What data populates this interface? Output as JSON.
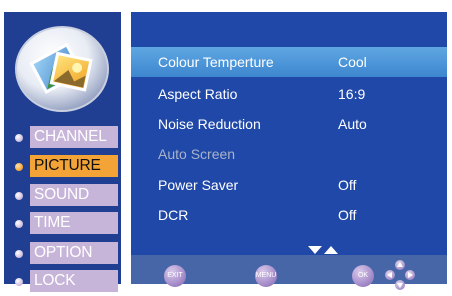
{
  "sidebar": {
    "items": [
      {
        "label": "CHANNEL",
        "active": false
      },
      {
        "label": "PICTURE",
        "active": true
      },
      {
        "label": "SOUND",
        "active": false
      },
      {
        "label": "TIME",
        "active": false
      },
      {
        "label": "OPTION",
        "active": false
      },
      {
        "label": "LOCK",
        "active": false
      }
    ]
  },
  "menu": {
    "rows": [
      {
        "label": "Colour Temperture",
        "value": "Cool",
        "selected": true,
        "disabled": false
      },
      {
        "label": "Aspect Ratio",
        "value": "16:9",
        "selected": false,
        "disabled": false
      },
      {
        "label": "Noise Reduction",
        "value": "Auto",
        "selected": false,
        "disabled": false
      },
      {
        "label": "Auto Screen",
        "value": "",
        "selected": false,
        "disabled": true
      },
      {
        "label": "Power Saver",
        "value": "Off",
        "selected": false,
        "disabled": false
      },
      {
        "label": "DCR",
        "value": "Off",
        "selected": false,
        "disabled": false
      }
    ]
  },
  "buttons": {
    "exit_label": "EXIT",
    "menu_label": "MENU",
    "ok_label": "OK"
  },
  "icons": {
    "logo": "picture-logo-icon",
    "scroll": "scroll-arrows-icon",
    "navigate": "dpad-icon"
  },
  "colors": {
    "panel_bg": "#1f48a8",
    "sidebar_bg": "#203f92",
    "selected_row": "#4a95d9",
    "active_tab": "#f4a336",
    "inactive_tab": "#c7b4d9",
    "button_bar": "#4766a8"
  }
}
